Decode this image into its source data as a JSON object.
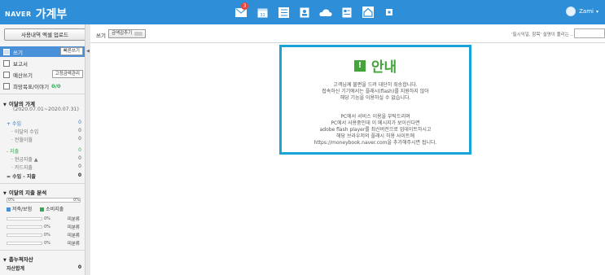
{
  "header": {
    "brand": "NAVER",
    "app_title": "가계부",
    "mail_badge": "3",
    "user_name": "Zami",
    "caret": "▾"
  },
  "sidebar": {
    "upload_button": "사용내역 엑셀 업로드",
    "menu": [
      {
        "label": "쓰기",
        "button": "빠른쓰기"
      },
      {
        "label": "보고서"
      },
      {
        "label": "예산쓰기",
        "button": "고정금액관리"
      },
      {
        "label": "희망목표/이야기",
        "count": "0/0"
      }
    ],
    "monthly": {
      "title": "이달의 가계",
      "period": "(2020.07.01~2020.07.31)",
      "rows": [
        {
          "label": "수입",
          "value": "0",
          "kind": "main"
        },
        {
          "label": "이달의 수입",
          "value": "0",
          "kind": "sub"
        },
        {
          "label": "전월이월",
          "value": "0",
          "kind": "sub"
        },
        {
          "label": "지출",
          "value": "0",
          "kind": "main-green"
        },
        {
          "label": "현금지출",
          "value": "0",
          "kind": "sub"
        },
        {
          "label": "카드지출",
          "value": "0",
          "kind": "sub"
        },
        {
          "label": "수입 - 지출",
          "value": "0",
          "kind": "total"
        }
      ]
    },
    "analysis": {
      "title": "이달의 지출 분석",
      "progress_left": "0%",
      "progress_right": "0%",
      "legend": [
        {
          "label": "저축/보험",
          "color": "#4a90d9"
        },
        {
          "label": "소비지출",
          "color": "#34a853"
        }
      ],
      "categories": [
        {
          "pct": "0%",
          "label": "미분류"
        },
        {
          "pct": "0%",
          "label": "미분류"
        },
        {
          "pct": "0%",
          "label": "미분류"
        },
        {
          "pct": "0%",
          "label": "미분류"
        }
      ]
    },
    "assets": {
      "title": "총누적자산",
      "row_label": "자산합계",
      "row_value": "0"
    }
  },
  "toolbar": {
    "label": "쓰기",
    "button": "금액감추기",
    "search_hint": "'필시익일, 항목' 설명이 풀리는 ..",
    "search_value": ""
  },
  "notice": {
    "title": "안내",
    "lines1": [
      "고객님께 불편을 드려 대단히 죄송합니다.",
      "접속하신 기기에서는 플래시(flash)를 지원하지 않아",
      "해당 기능을 이용하실 수 없습니다."
    ],
    "lines2": [
      "PC에서 서비스 이용을 부탁드리며",
      "PC에서 사용중인데 이 메시지가 보이신다면",
      "adobe flash player를 최신버전으로 업데이트하시고",
      "해당 브라우저의 플래시 허용 사이트에"
    ],
    "link": "https://moneybook.naver.com",
    "link_suffix": "을 추가해주시면 됩니다."
  },
  "colors": {
    "header": "#2e8fd8",
    "accent_green": "#42a43a",
    "notice_border": "#1aa3d6",
    "active": "#4a90d9"
  }
}
